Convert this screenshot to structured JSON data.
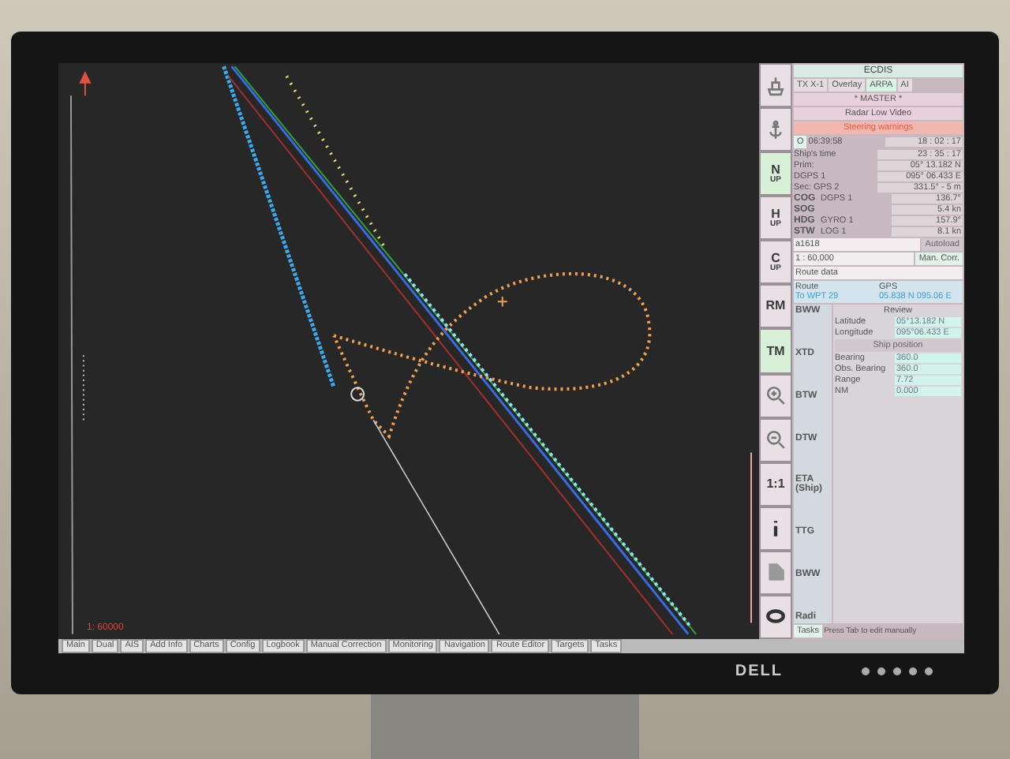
{
  "chart": {
    "scale_label": "1: 60000"
  },
  "tool_buttons": [
    {
      "kind": "ship"
    },
    {
      "kind": "anchor"
    },
    {
      "kind": "text",
      "label": "N",
      "sub": "UP",
      "selected": true
    },
    {
      "kind": "text",
      "label": "H",
      "sub": "UP",
      "selected": false
    },
    {
      "kind": "text",
      "label": "C",
      "sub": "UP",
      "selected": false
    },
    {
      "kind": "text",
      "label": "RM",
      "selected": false
    },
    {
      "kind": "text",
      "label": "TM",
      "selected": true
    },
    {
      "kind": "zoomin"
    },
    {
      "kind": "zoomout"
    },
    {
      "kind": "text",
      "label": "1:1",
      "selected": false
    },
    {
      "kind": "info"
    },
    {
      "kind": "chart"
    },
    {
      "kind": "ring"
    }
  ],
  "panel": {
    "title": "ECDIS",
    "mode_tabs": [
      {
        "label": "TX X-1",
        "selected": false
      },
      {
        "label": "Overlay",
        "selected": false
      },
      {
        "label": "ARPA",
        "selected": true
      },
      {
        "label": "AI",
        "selected": false
      }
    ],
    "banners": [
      {
        "kind": "info",
        "text": "* MASTER *"
      },
      {
        "kind": "info",
        "text": "Radar Low Video"
      },
      {
        "kind": "alarm",
        "text": "Steering warnings"
      }
    ],
    "clock_button": "O",
    "times": [
      {
        "label": "06:39:58",
        "value": "18 : 02 : 17"
      },
      {
        "label": "Ship's time",
        "value": "23 : 35 : 17"
      }
    ],
    "position": [
      {
        "label": "Prim:",
        "value": "05° 13.182 N"
      },
      {
        "label": "DGPS 1",
        "value": "095° 06.433 E"
      },
      {
        "label": "Sec: GPS 2",
        "value": "331.5° - 5 m"
      }
    ],
    "nav": [
      {
        "name": "COG",
        "source": "DGPS 1",
        "value": "136.7°"
      },
      {
        "name": "SOG",
        "value": "5.4 kn"
      },
      {
        "name": "HDG",
        "source": "GYRO 1",
        "value": "157.9°"
      },
      {
        "name": "STW",
        "source": "LOG 1",
        "value": "8.1 kn"
      }
    ],
    "chart_select": {
      "value": "a1618",
      "autoload": "Autoload",
      "scale": "1 : 60,000",
      "man_corr": "Man. Corr."
    },
    "route_data": "Route data",
    "route_head": [
      "Route",
      "GPS"
    ],
    "route_row": [
      "To WPT 29",
      "05.838 N 095.06 E"
    ],
    "route_labels": [
      "BWW",
      "XTD",
      "BTW",
      "DTW",
      "ETA (Ship)",
      "TTG",
      "BWW",
      "Radi"
    ],
    "review": {
      "title": "Review",
      "fields": [
        {
          "label": "Latitude",
          "value": "05°13.182 N"
        },
        {
          "label": "Longitude",
          "value": "095°06.433 E"
        }
      ],
      "ship_button": "Ship position",
      "fields2": [
        {
          "label": "Bearing",
          "value": "360.0"
        },
        {
          "label": "Obs. Bearing",
          "value": "360.0"
        },
        {
          "label": "Range",
          "value": "7.72"
        }
      ],
      "unit": "NM",
      "value4": "0.000"
    },
    "tasks": "Tasks",
    "hint": "Press Tab to edit manually"
  },
  "bottom_tabs": [
    {
      "label": "Main",
      "selected": false
    },
    {
      "label": "Dual",
      "selected": false
    },
    {
      "label": "AIS",
      "selected": false
    },
    {
      "label": "Add Info",
      "selected": false
    },
    {
      "label": "Charts",
      "selected": false
    },
    {
      "label": "Config",
      "selected": false
    },
    {
      "label": "Logbook",
      "selected": false
    },
    {
      "label": "Manual Correction",
      "selected": false
    },
    {
      "label": "Monitoring",
      "selected": false
    },
    {
      "label": "Navigation",
      "selected": false
    },
    {
      "label": "Route Editor",
      "selected": false
    },
    {
      "label": "Targets",
      "selected": false
    },
    {
      "label": "Tasks",
      "selected": false
    }
  ],
  "monitor": {
    "logo": "DELL"
  }
}
